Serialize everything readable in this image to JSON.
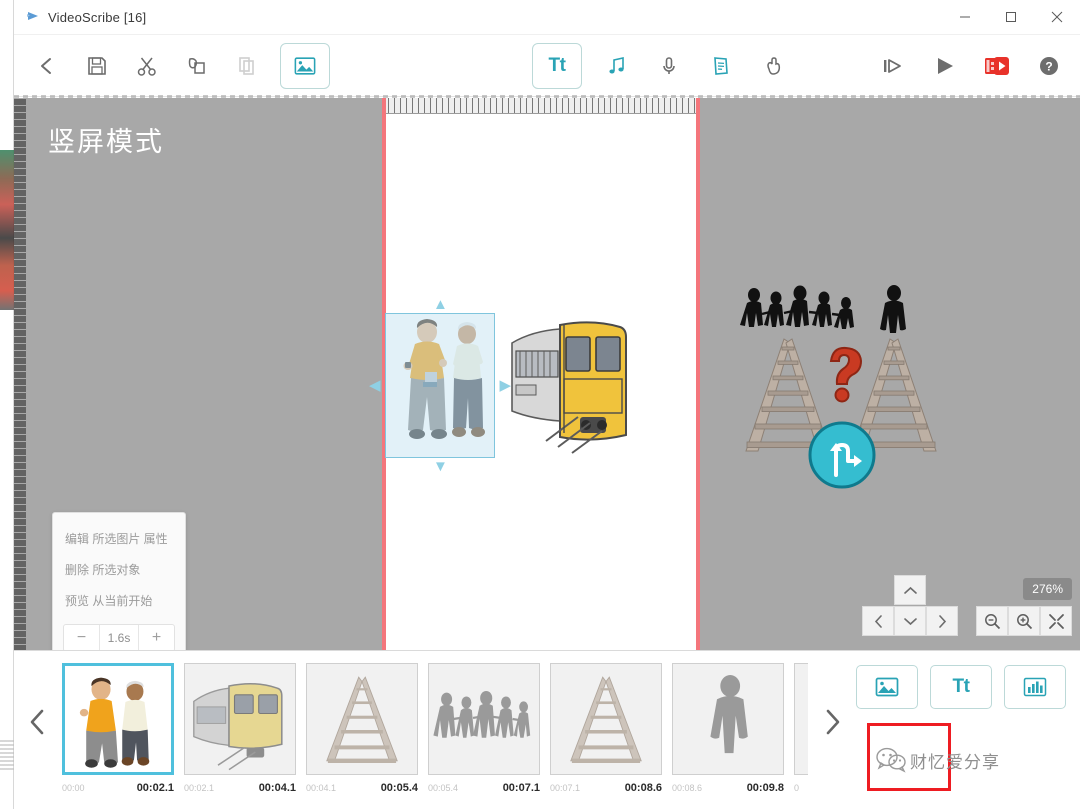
{
  "window": {
    "title": "VideoScribe [16]",
    "app_icon": "play-logo-icon",
    "minimize": "─",
    "maximize": "□",
    "close": "✕"
  },
  "toolbar": {
    "left": [
      {
        "name": "back-button",
        "icon": "chevron-left-icon",
        "glyph": "‹",
        "state": "enabled"
      },
      {
        "name": "save-button",
        "icon": "floppy-disk-icon",
        "glyph": "💾",
        "state": "enabled"
      },
      {
        "name": "cut-button",
        "icon": "scissors-icon",
        "glyph": "✂",
        "state": "enabled"
      },
      {
        "name": "copy-button",
        "icon": "copy-icon",
        "glyph": "⧉",
        "state": "enabled"
      },
      {
        "name": "paste-button",
        "icon": "paste-icon",
        "glyph": "❐",
        "state": "disabled"
      },
      {
        "name": "add-image-button",
        "icon": "image-icon",
        "glyph": "🖼",
        "state": "active"
      }
    ],
    "center": [
      {
        "name": "add-text-button",
        "icon": "text-icon",
        "label": "Tt",
        "state": "active"
      },
      {
        "name": "add-music-button",
        "icon": "music-note-icon",
        "glyph": "♫",
        "state": "enabled"
      },
      {
        "name": "record-voice-button",
        "icon": "microphone-icon",
        "glyph": "🎤",
        "state": "enabled"
      },
      {
        "name": "paper-button",
        "icon": "document-icon",
        "glyph": "📄",
        "state": "enabled"
      },
      {
        "name": "hand-button",
        "icon": "hand-icon",
        "glyph": "✋",
        "state": "enabled"
      }
    ],
    "right": [
      {
        "name": "play-from-here-button",
        "icon": "play-from-icon",
        "glyph": "▶|",
        "state": "enabled"
      },
      {
        "name": "play-button",
        "icon": "play-icon",
        "glyph": "▶",
        "state": "enabled"
      },
      {
        "name": "publish-button",
        "icon": "publish-video-icon",
        "glyph": "▶",
        "state": "enabled"
      },
      {
        "name": "help-button",
        "icon": "help-question-icon",
        "glyph": "?",
        "state": "enabled"
      }
    ]
  },
  "canvas": {
    "mode_label": "竖屏模式",
    "zoom_level": "276%",
    "guide_color": "#f4767c",
    "background_color": "#a8a8a8",
    "paper_color": "#ffffff",
    "selection": {
      "name": "selected-image-two-men",
      "handles": [
        "up",
        "down",
        "left",
        "right"
      ]
    }
  },
  "context_menu": {
    "items": [
      {
        "name": "edit-image-properties",
        "label": "编辑 所选图片 属性"
      },
      {
        "name": "delete-selected-object",
        "label": "删除 所选对象"
      },
      {
        "name": "preview-from-here",
        "label": "预览 从当前开始"
      }
    ],
    "duration_stepper": {
      "decrease": "−",
      "value": "1.6s",
      "increase": "+"
    }
  },
  "zoom_controls": {
    "pad": [
      {
        "name": "pan-up-button",
        "glyph": "∧"
      },
      {
        "name": "pan-left-button",
        "glyph": "‹"
      },
      {
        "name": "pan-down-button",
        "glyph": "∨"
      },
      {
        "name": "pan-right-button",
        "glyph": "›"
      }
    ],
    "zoom_out": {
      "name": "zoom-out-button",
      "glyph": "−"
    },
    "zoom_in": {
      "name": "zoom-in-button",
      "glyph": "+"
    },
    "fit_screen": {
      "name": "fit-to-screen-button",
      "glyph": "✕"
    },
    "percent": "276%"
  },
  "timeline": {
    "prev_label": "‹",
    "next_label": "›",
    "frames": [
      {
        "name": "timeline-frame-1",
        "art": "two-men",
        "start": "00:00",
        "end": "00:02.1",
        "selected": true
      },
      {
        "name": "timeline-frame-2",
        "art": "train",
        "start": "00:02.1",
        "end": "00:04.1",
        "selected": false
      },
      {
        "name": "timeline-frame-3",
        "art": "track",
        "start": "00:04.1",
        "end": "00:05.4",
        "selected": false
      },
      {
        "name": "timeline-frame-4",
        "art": "family",
        "start": "00:05.4",
        "end": "00:07.1",
        "selected": false
      },
      {
        "name": "timeline-frame-5",
        "art": "track",
        "start": "00:07.1",
        "end": "00:08.6",
        "selected": false
      },
      {
        "name": "timeline-frame-6",
        "art": "person",
        "start": "00:08.6",
        "end": "00:09.8",
        "selected": false
      },
      {
        "name": "timeline-frame-7",
        "art": "blank",
        "start": "0",
        "end": "",
        "selected": false
      }
    ],
    "add_buttons": [
      {
        "name": "add-image-timeline-button",
        "icon": "image-icon"
      },
      {
        "name": "add-text-timeline-button",
        "icon": "text-icon",
        "label": "Tt"
      },
      {
        "name": "add-chart-timeline-button",
        "icon": "chart-icon"
      }
    ],
    "watermark": {
      "name": "wechat-watermark",
      "icon": "wechat-icon",
      "text": "财忆爱分享"
    }
  }
}
